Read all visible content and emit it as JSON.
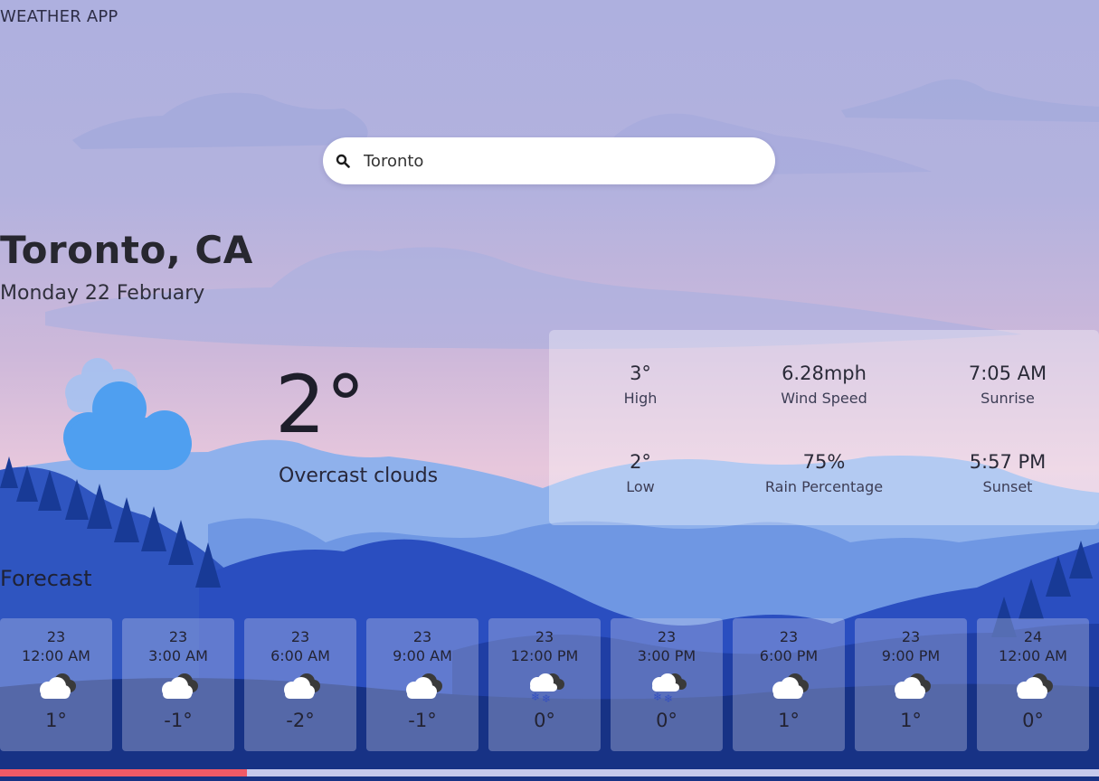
{
  "app": {
    "title": "WEATHER APP"
  },
  "search": {
    "value": "Toronto",
    "icon": "search-icon"
  },
  "location": {
    "city": "Toronto, CA",
    "date": "Monday 22 February"
  },
  "current": {
    "temperature": "2°",
    "condition": "Overcast clouds",
    "icon": "cloud-icon"
  },
  "stats": [
    {
      "value": "3°",
      "label": "High"
    },
    {
      "value": "6.28mph",
      "label": "Wind Speed"
    },
    {
      "value": "7:05 AM",
      "label": "Sunrise"
    },
    {
      "value": "2°",
      "label": "Low"
    },
    {
      "value": "75%",
      "label": "Rain Percentage"
    },
    {
      "value": "5:57 PM",
      "label": "Sunset"
    }
  ],
  "forecast": {
    "title": "Forecast",
    "items": [
      {
        "day": "23",
        "time": "12:00 AM",
        "icon": "cloud-moon-icon",
        "temp": "1°"
      },
      {
        "day": "23",
        "time": "3:00 AM",
        "icon": "cloud-moon-icon",
        "temp": "-1°"
      },
      {
        "day": "23",
        "time": "6:00 AM",
        "icon": "cloud-moon-icon",
        "temp": "-2°"
      },
      {
        "day": "23",
        "time": "9:00 AM",
        "icon": "cloud-moon-icon",
        "temp": "-1°"
      },
      {
        "day": "23",
        "time": "12:00 PM",
        "icon": "snow-cloud-icon",
        "temp": "0°"
      },
      {
        "day": "23",
        "time": "3:00 PM",
        "icon": "snow-cloud-icon",
        "temp": "0°"
      },
      {
        "day": "23",
        "time": "6:00 PM",
        "icon": "cloud-moon-icon",
        "temp": "1°"
      },
      {
        "day": "23",
        "time": "9:00 PM",
        "icon": "cloud-moon-icon",
        "temp": "1°"
      },
      {
        "day": "24",
        "time": "12:00 AM",
        "icon": "cloud-moon-icon",
        "temp": "0°"
      }
    ]
  },
  "scroll": {
    "progress": 0.225
  },
  "colors": {
    "accent": "#f05a66",
    "cloud": "#4f9ff0",
    "track": "#c6c9ec"
  }
}
